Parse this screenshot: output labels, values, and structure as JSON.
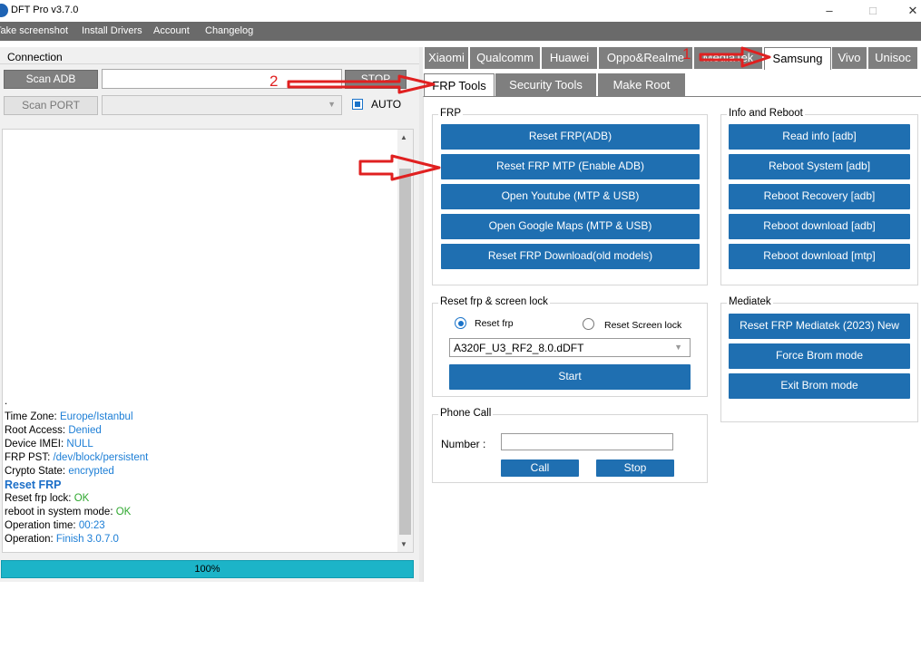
{
  "window": {
    "title": "DFT Pro v3.7.0",
    "controls": {
      "minimize": "–",
      "maximize": "□",
      "close": "✕"
    }
  },
  "menu": [
    "Take screenshot",
    "Install Drivers",
    "Account",
    "Changelog"
  ],
  "connection": {
    "title": "Connection",
    "scan_adb_label": "Scan ADB",
    "scan_port_label": "Scan PORT",
    "adb_input_value": "",
    "stop_label": "STOP",
    "auto_label": "AUTO",
    "auto_checked": true
  },
  "log": {
    "dot": ".",
    "lines": [
      {
        "label": "Time Zone: ",
        "value": "Europe/Istanbul",
        "color": "blue"
      },
      {
        "label": "Root Access: ",
        "value": "Denied",
        "color": "blue"
      },
      {
        "label": "Device IMEI: ",
        "value": "NULL",
        "color": "blue"
      },
      {
        "label": "FRP PST: ",
        "value": "/dev/block/persistent",
        "color": "blue"
      },
      {
        "label": "Crypto State: ",
        "value": "encrypted",
        "color": "blue"
      },
      {
        "label": "Reset FRP",
        "value": "",
        "color": "heading"
      },
      {
        "label": "Reset frp lock: ",
        "value": "OK",
        "color": "green"
      },
      {
        "label": "reboot in system mode: ",
        "value": "OK",
        "color": "green"
      },
      {
        "label": "Operation time: ",
        "value": "00:23",
        "color": "blue"
      },
      {
        "label": "Operation: ",
        "value": "Finish 3.0.7.0",
        "color": "blue"
      }
    ]
  },
  "progress": {
    "value": 1.0,
    "text": "100%"
  },
  "brand_tabs": [
    "Xiaomi",
    "Qualcomm",
    "Huawei",
    "Oppo&Realme",
    "MediaTek",
    "Samsung",
    "Vivo",
    "Unisoc"
  ],
  "active_brand_tab": "Samsung",
  "sub_tabs": [
    "FRP Tools",
    "Security Tools",
    "Make Root"
  ],
  "active_sub_tab": "FRP Tools",
  "annotations": {
    "num1": "1",
    "num2": "2"
  },
  "frp": {
    "title": "FRP",
    "buttons": [
      "Reset FRP(ADB)",
      "Reset FRP MTP (Enable ADB)",
      "Open Youtube (MTP & USB)",
      "Open Google Maps (MTP & USB)",
      "Reset FRP Download(old models)"
    ]
  },
  "info_reboot": {
    "title": "Info and Reboot",
    "buttons": [
      "Read info [adb]",
      "Reboot System [adb]",
      "Reboot Recovery [adb]",
      "Reboot download [adb]",
      "Reboot download [mtp]"
    ]
  },
  "reset_lock": {
    "title": "Reset frp & screen lock",
    "radio_frp": "Reset frp",
    "radio_screen": "Reset Screen lock",
    "selected": "Reset frp",
    "model_value": "A320F_U3_RF2_8.0.dDFT",
    "start_label": "Start"
  },
  "mediatek": {
    "title": "Mediatek",
    "buttons": [
      "Reset FRP Mediatek (2023) New",
      "Force Brom mode",
      "Exit Brom mode"
    ]
  },
  "phone_call": {
    "title": "Phone Call",
    "number_label": "Number :",
    "number_value": "",
    "call_label": "Call",
    "stop_label": "Stop"
  },
  "colors": {
    "accent_button": "#1f6fb1",
    "tab_gray": "#7f7f7f",
    "progress": "#1cb4c8",
    "annotation_red": "#e02020",
    "log_blue": "#1c7ed6",
    "log_green": "#2fa82f"
  }
}
